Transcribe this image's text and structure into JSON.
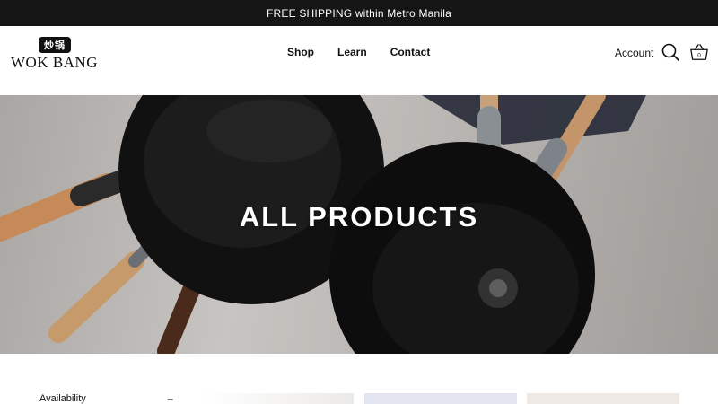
{
  "announcement": "FREE SHIPPING within Metro Manila",
  "brand": {
    "name": "WOK BANG",
    "mark_text": "炒锅"
  },
  "nav": [
    {
      "label": "Shop"
    },
    {
      "label": "Learn"
    },
    {
      "label": "Contact"
    }
  ],
  "header": {
    "account_label": "Account",
    "cart_count": "0"
  },
  "icons": {
    "search": "search-icon",
    "cart": "basket-icon"
  },
  "hero": {
    "title": "ALL PRODUCTS"
  },
  "filters": {
    "availability_label": "Availability",
    "availability_toggle": "−"
  },
  "colors": {
    "announcement_bg": "#151515",
    "accent": "#111111"
  }
}
